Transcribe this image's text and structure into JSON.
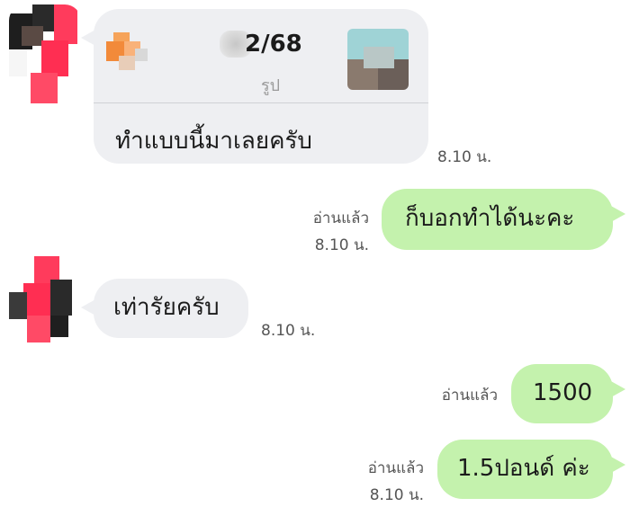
{
  "messages": [
    {
      "direction": "incoming",
      "reply_preview": {
        "date_text": "2/68",
        "sub_text": "รูป"
      },
      "text": "ทำแบบนี้มาเลยครับ",
      "time": "8.10 น."
    },
    {
      "direction": "outgoing",
      "read_status": "อ่านแล้ว",
      "text": "ก็บอกทำได้นะคะ",
      "time": "8.10 น."
    },
    {
      "direction": "incoming",
      "text": "เท่ารัยครับ",
      "time": "8.10 น."
    },
    {
      "direction": "outgoing",
      "read_status": "อ่านแล้ว",
      "text": "1500"
    },
    {
      "direction": "outgoing",
      "read_status": "อ่านแล้ว",
      "text": "1.5ปอนด์ ค่ะ",
      "time": "8.10 น."
    }
  ],
  "colors": {
    "incoming_bubble": "#eeeff2",
    "outgoing_bubble": "#c4f2ad",
    "timestamp_text": "#555555",
    "avatar_accent": "#ff3b5c"
  },
  "icons": {
    "sender_avatar": "user-avatar-icon",
    "reply_thumbnail": "image-thumbnail-icon"
  }
}
